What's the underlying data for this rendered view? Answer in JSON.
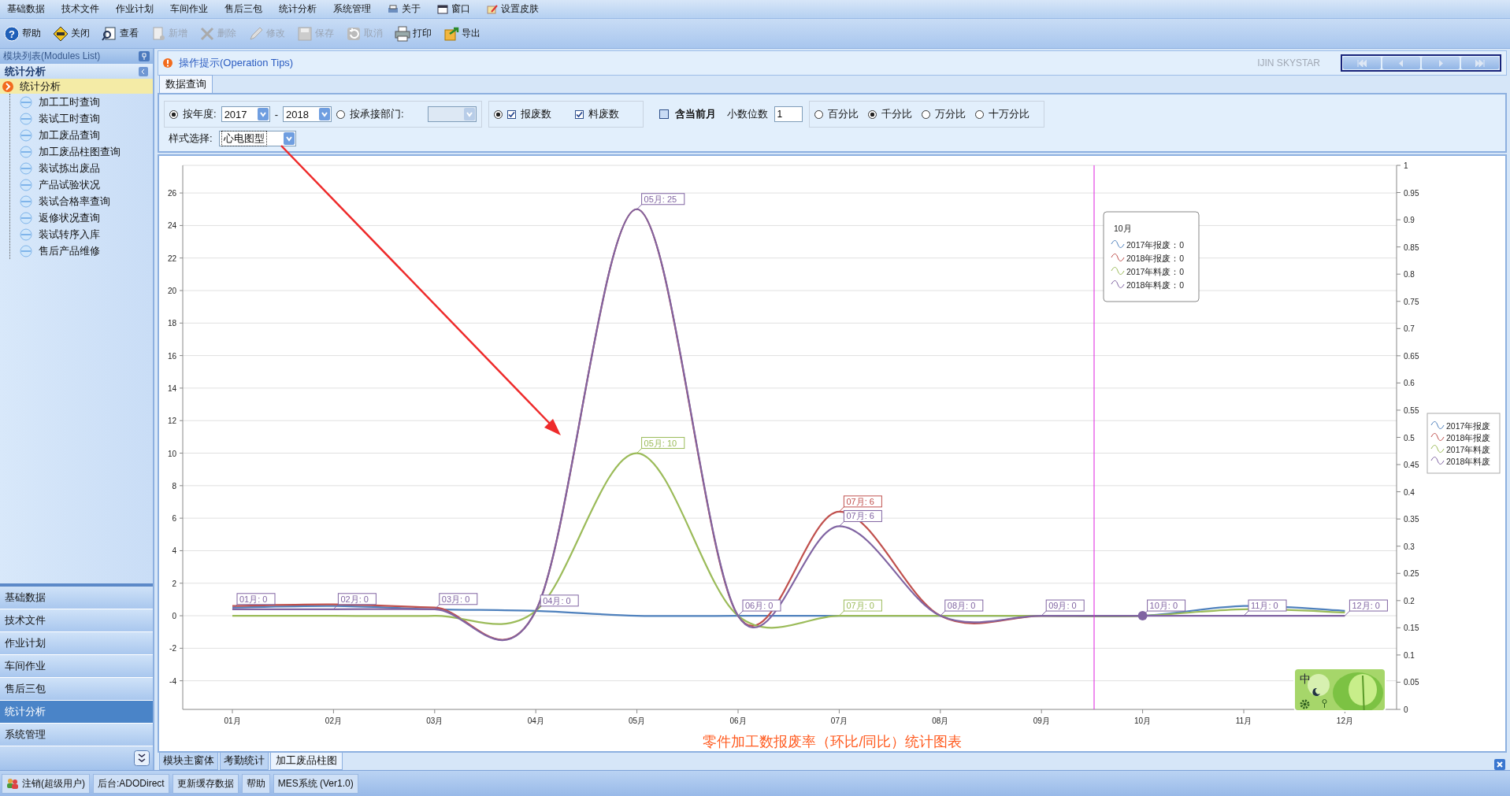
{
  "menu_bar": [
    {
      "label": "基础数据",
      "kind": "text"
    },
    {
      "label": "技术文件",
      "kind": "text"
    },
    {
      "label": "作业计划",
      "kind": "text"
    },
    {
      "label": "车间作业",
      "kind": "text"
    },
    {
      "label": "售后三包",
      "kind": "text"
    },
    {
      "label": "统计分析",
      "kind": "text"
    },
    {
      "label": "系统管理",
      "kind": "text"
    },
    {
      "label": "关于",
      "kind": "about"
    },
    {
      "label": "窗口",
      "kind": "window"
    },
    {
      "label": "设置皮肤",
      "kind": "skin"
    }
  ],
  "toolbar": [
    {
      "label": "帮助",
      "kind": "help",
      "disabled": false,
      "icon_glyph": "?"
    },
    {
      "label": "关闭",
      "kind": "exit",
      "disabled": false
    },
    {
      "label": "查看",
      "kind": "view",
      "disabled": false
    },
    {
      "label": "新增",
      "kind": "new",
      "disabled": true
    },
    {
      "label": "删除",
      "kind": "delete",
      "disabled": true
    },
    {
      "label": "修改",
      "kind": "edit",
      "disabled": true
    },
    {
      "label": "保存",
      "kind": "save",
      "disabled": true
    },
    {
      "label": "取消",
      "kind": "cancel",
      "disabled": true
    },
    {
      "label": "打印",
      "kind": "print",
      "disabled": false
    },
    {
      "label": "导出",
      "kind": "export",
      "disabled": false
    }
  ],
  "module_panel": {
    "title": "模块列表(Modules List)",
    "group_title": "统计分析",
    "tree": [
      {
        "label": "统计分析",
        "selected": true,
        "children": [
          {
            "label": "加工工时查询",
            "selected": false
          },
          {
            "label": "装试工时查询",
            "selected": false
          },
          {
            "label": "加工废品查询",
            "selected": false
          },
          {
            "label": "加工废品柱图查询",
            "selected": false
          },
          {
            "label": "装试拣出废品",
            "selected": false
          },
          {
            "label": "产品试验状况",
            "selected": false
          },
          {
            "label": "装试合格率查询",
            "selected": false
          },
          {
            "label": "返修状况查询",
            "selected": false
          },
          {
            "label": "装试转序入库",
            "selected": false
          },
          {
            "label": "售后产品维修",
            "selected": false
          }
        ]
      }
    ]
  },
  "nav_groups": [
    {
      "label": "基础数据",
      "selected": false
    },
    {
      "label": "技术文件",
      "selected": false
    },
    {
      "label": "作业计划",
      "selected": false
    },
    {
      "label": "车间作业",
      "selected": false
    },
    {
      "label": "售后三包",
      "selected": false
    },
    {
      "label": "统计分析",
      "selected": true
    },
    {
      "label": "系统管理",
      "selected": false
    }
  ],
  "operation_tips": "操作提示(Operation Tips)",
  "brand_text": "IJIN SKYSTAR",
  "record_nav": [
    {
      "kind": "first"
    },
    {
      "kind": "prev"
    },
    {
      "kind": "next"
    },
    {
      "kind": "last"
    }
  ],
  "query_tabs": [
    {
      "label": "数据查询",
      "selected": true
    }
  ],
  "filters": {
    "by_year": {
      "label": "按年度:",
      "selected": true,
      "from": "2017",
      "separator": "-",
      "to": "2018"
    },
    "by_dept": {
      "label": "按承接部门:",
      "selected": false,
      "disabled": true
    },
    "count_radio": {
      "selected": true
    },
    "count_options": [
      {
        "label": "报废数",
        "checked": true
      },
      {
        "label": "料废数",
        "checked": true
      }
    ],
    "include_current_month": {
      "label": "含当前月",
      "checked": false
    },
    "decimals": {
      "label": "小数位数",
      "value": "1"
    },
    "ratio_options": [
      {
        "label": "百分比",
        "selected": false
      },
      {
        "label": "千分比",
        "selected": true
      },
      {
        "label": "万分比",
        "selected": false
      },
      {
        "label": "十万分比",
        "selected": false
      }
    ],
    "style_select": {
      "label": "样式选择:",
      "value": "心电图型"
    }
  },
  "chart": {
    "chart_data": {
      "type": "line",
      "title": "零件加工数报废率（环比/同比）统计图表",
      "categories": [
        "01月",
        "02月",
        "03月",
        "04月",
        "05月",
        "06月",
        "07月",
        "08月",
        "09月",
        "10月",
        "11月",
        "12月"
      ],
      "series": [
        {
          "name": "2017年报废",
          "color": "#4f81bd",
          "values": [
            0.5,
            0.6,
            0.4,
            0.3,
            0,
            0,
            0,
            0,
            0,
            0,
            0.6,
            0.3
          ]
        },
        {
          "name": "2018年报废",
          "color": "#c0504d",
          "values": [
            0.6,
            0.7,
            0.5,
            0.3,
            25,
            0,
            6.4,
            0,
            0,
            0,
            null,
            null
          ]
        },
        {
          "name": "2017年料废",
          "color": "#9bbb59",
          "values": [
            0,
            0,
            0,
            0.3,
            10,
            0,
            0,
            0,
            0,
            0,
            0.4,
            0.2
          ]
        },
        {
          "name": "2018年料废",
          "color": "#8064a2",
          "values": [
            0.4,
            0.4,
            0.4,
            0.3,
            25,
            0,
            5.5,
            0,
            0,
            0,
            0,
            0
          ]
        }
      ],
      "ylim": [
        -5.76,
        27.7
      ],
      "yticks": [
        -4,
        -2,
        0,
        2,
        4,
        6,
        8,
        10,
        12,
        14,
        16,
        18,
        20,
        22,
        24,
        26
      ],
      "y2lim": [
        0,
        1
      ],
      "y2ticks": [
        0,
        0.05,
        0.1,
        0.15,
        0.2,
        0.25,
        0.3,
        0.35,
        0.4,
        0.45,
        0.5,
        0.55,
        0.6,
        0.65,
        0.7,
        0.75,
        0.8,
        0.85,
        0.9,
        0.95,
        1
      ],
      "grid": true,
      "legend": "right",
      "annotations": [
        {
          "x": "01月",
          "y": 0.4,
          "text": "01月: 0"
        },
        {
          "x": "02月",
          "y": 0.4,
          "text": "02月: 0"
        },
        {
          "x": "03月",
          "y": 0.4,
          "text": "03月: 0"
        },
        {
          "x": "04月",
          "y": 0.3,
          "text": "04月: 0"
        },
        {
          "x": "05月",
          "y": 25,
          "text": "05月: 25"
        },
        {
          "x": "05月",
          "y": 10,
          "text": "05月: 10"
        },
        {
          "x": "06月",
          "y": 0,
          "text": "06月: 0"
        },
        {
          "x": "07月",
          "y": 6.4,
          "text": "07月: 6"
        },
        {
          "x": "07月",
          "y": 5.5,
          "text": "07月: 6"
        },
        {
          "x": "07月",
          "y": 0,
          "text": "07月: 0"
        },
        {
          "x": "08月",
          "y": 0,
          "text": "08月: 0"
        },
        {
          "x": "09月",
          "y": 0,
          "text": "09月: 0"
        },
        {
          "x": "10月",
          "y": 0,
          "text": "10月: 0"
        },
        {
          "x": "11月",
          "y": 0,
          "text": "11月: 0"
        },
        {
          "x": "12月",
          "y": 0,
          "text": "12月: 0"
        }
      ]
    },
    "tooltip": {
      "title": "10月",
      "rows": [
        {
          "text": "2017年报废：0"
        },
        {
          "text": "2018年报废：0"
        },
        {
          "text": "2017年料废：0"
        },
        {
          "text": "2018年料废：0"
        }
      ]
    }
  },
  "bottom_tabs": [
    {
      "label": "模块主窗体",
      "selected": false
    },
    {
      "label": "考勤统计",
      "selected": false
    },
    {
      "label": "加工废品柱图",
      "selected": true
    }
  ],
  "ime_toolbar": {
    "label": "中"
  },
  "status_bar": [
    {
      "label": "注销(超级用户)",
      "kind": "user"
    },
    {
      "label": "后台:ADODirect",
      "kind": "text"
    },
    {
      "label": "更新缓存数据",
      "kind": "text"
    },
    {
      "label": "帮助",
      "kind": "text"
    },
    {
      "label": "MES系统 (Ver1.0)",
      "kind": "text"
    }
  ]
}
